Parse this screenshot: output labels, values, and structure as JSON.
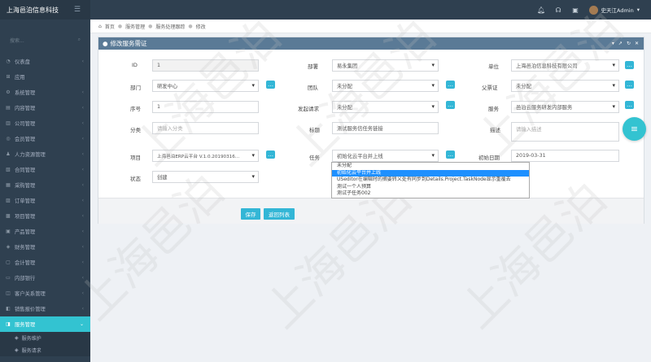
{
  "app": {
    "title": "上海邑泊信息科技",
    "menu_icon": "hamburger-icon"
  },
  "topbar": {
    "user_name": "史天江Admin",
    "user_caret": "▾",
    "icons": [
      "bell-icon",
      "headset-icon",
      "calendar-icon"
    ]
  },
  "sidebar": {
    "search_placeholder": "搜索...",
    "items": [
      {
        "label": "仪表盘",
        "icon": "dashboard-icon"
      },
      {
        "label": "应用",
        "icon": "apps-icon"
      },
      {
        "label": "系统管理",
        "icon": "gear-icon"
      },
      {
        "label": "内容管理",
        "icon": "content-icon"
      },
      {
        "label": "公司管理",
        "icon": "company-icon"
      },
      {
        "label": "会员管理",
        "icon": "member-icon"
      },
      {
        "label": "人力资源管理",
        "icon": "hr-icon"
      },
      {
        "label": "合同管理",
        "icon": "contract-icon"
      },
      {
        "label": "采购管理",
        "icon": "purchase-icon"
      },
      {
        "label": "订单管理",
        "icon": "order-icon"
      },
      {
        "label": "项目管理",
        "icon": "project-icon"
      },
      {
        "label": "产品管理",
        "icon": "product-icon"
      },
      {
        "label": "财务管理",
        "icon": "finance-icon"
      },
      {
        "label": "会计管理",
        "icon": "accounting-icon"
      },
      {
        "label": "内部银行",
        "icon": "bank-icon"
      },
      {
        "label": "客户关系管理",
        "icon": "crm-icon"
      },
      {
        "label": "销售报价管理",
        "icon": "quote-icon"
      },
      {
        "label": "服务管理",
        "icon": "service-icon"
      }
    ],
    "sub_items": [
      {
        "label": "服务维护"
      },
      {
        "label": "服务请求"
      }
    ]
  },
  "breadcrumb": {
    "home": "首页",
    "level1": "服务管理",
    "level2": "服务处理跟踪",
    "level3": "修改"
  },
  "panel": {
    "title": "修改服务需证",
    "tools": [
      "▾",
      "↗",
      "↻",
      "✕"
    ]
  },
  "form": {
    "id": {
      "label": "ID",
      "value": "1"
    },
    "tenant": {
      "label": "部署",
      "value": "易永集团"
    },
    "unit": {
      "label": "单位",
      "value": "上海邑泊信息科技有限公司"
    },
    "dept": {
      "label": "部门",
      "value": "研发中心"
    },
    "person": {
      "label": "团队",
      "value": "未分配"
    },
    "cert": {
      "label": "父票证",
      "value": "未分配"
    },
    "seq": {
      "label": "序号",
      "value": "1"
    },
    "request": {
      "label": "发起请求",
      "value": "未分配"
    },
    "service": {
      "label": "服务",
      "value": "邑泊云服务研发内部服务"
    },
    "category": {
      "label": "分类",
      "placeholder": "请输入分类"
    },
    "title": {
      "label": "标题",
      "value": "测试服务信任务链接"
    },
    "desc": {
      "label": "描述",
      "placeholder": "请输入描述"
    },
    "project": {
      "label": "项目",
      "value": "上海邑泊ERP云平台 V.1.0.20190316..."
    },
    "task": {
      "label": "任务",
      "value": "初始化云平台并上线"
    },
    "start_date": {
      "label": "初始日期",
      "value": "2019-03-31"
    },
    "status": {
      "label": "状态",
      "value": "创建"
    },
    "task_options": [
      "未分配",
      "初始化云平台并上线",
      "USeditor在编辑时的摘要转义处有同步到Details.Project.TaskNode显示重覆去",
      "测试一个人预算",
      "测试子任务002"
    ],
    "task_selected_index": 1
  },
  "buttons": {
    "save": "保存",
    "back": "返回列表"
  },
  "fab": {
    "icon": "menu-icon"
  },
  "watermark": "上海邑泊"
}
